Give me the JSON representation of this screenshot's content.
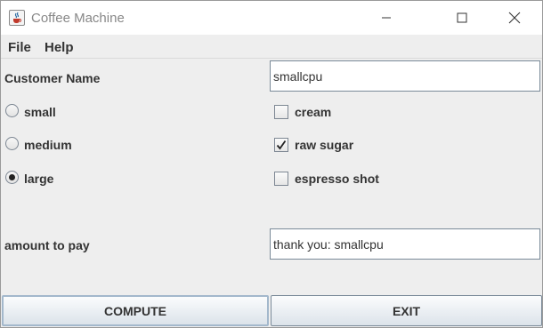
{
  "window": {
    "title": "Coffee Machine",
    "icon": "java-cup-icon"
  },
  "menu": {
    "items": [
      "File",
      "Help"
    ]
  },
  "form": {
    "customer_label": "Customer Name",
    "customer_value": "smallcpu",
    "sizes": [
      {
        "label": "small",
        "selected": false
      },
      {
        "label": "medium",
        "selected": false
      },
      {
        "label": "large",
        "selected": true
      }
    ],
    "extras": [
      {
        "label": "cream",
        "checked": false
      },
      {
        "label": "raw sugar",
        "checked": true
      },
      {
        "label": "espresso shot",
        "checked": false
      }
    ],
    "amount_label": "amount to pay",
    "amount_value": "thank you: smallcpu"
  },
  "buttons": {
    "compute": "COMPUTE",
    "exit": "EXIT"
  }
}
